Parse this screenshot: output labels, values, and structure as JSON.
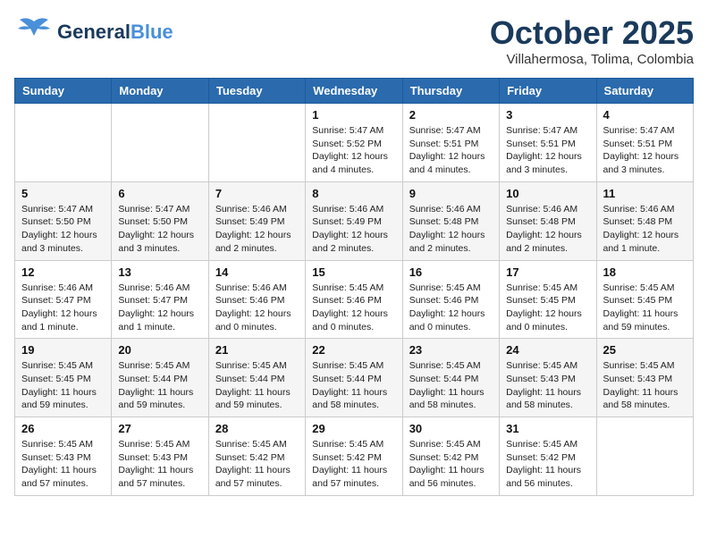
{
  "header": {
    "logo_general": "General",
    "logo_blue": "Blue",
    "month": "October 2025",
    "location": "Villahermosa, Tolima, Colombia"
  },
  "weekdays": [
    "Sunday",
    "Monday",
    "Tuesday",
    "Wednesday",
    "Thursday",
    "Friday",
    "Saturday"
  ],
  "weeks": [
    [
      {
        "day": "",
        "info": ""
      },
      {
        "day": "",
        "info": ""
      },
      {
        "day": "",
        "info": ""
      },
      {
        "day": "1",
        "info": "Sunrise: 5:47 AM\nSunset: 5:52 PM\nDaylight: 12 hours and 4 minutes."
      },
      {
        "day": "2",
        "info": "Sunrise: 5:47 AM\nSunset: 5:51 PM\nDaylight: 12 hours and 4 minutes."
      },
      {
        "day": "3",
        "info": "Sunrise: 5:47 AM\nSunset: 5:51 PM\nDaylight: 12 hours and 3 minutes."
      },
      {
        "day": "4",
        "info": "Sunrise: 5:47 AM\nSunset: 5:51 PM\nDaylight: 12 hours and 3 minutes."
      }
    ],
    [
      {
        "day": "5",
        "info": "Sunrise: 5:47 AM\nSunset: 5:50 PM\nDaylight: 12 hours and 3 minutes."
      },
      {
        "day": "6",
        "info": "Sunrise: 5:47 AM\nSunset: 5:50 PM\nDaylight: 12 hours and 3 minutes."
      },
      {
        "day": "7",
        "info": "Sunrise: 5:46 AM\nSunset: 5:49 PM\nDaylight: 12 hours and 2 minutes."
      },
      {
        "day": "8",
        "info": "Sunrise: 5:46 AM\nSunset: 5:49 PM\nDaylight: 12 hours and 2 minutes."
      },
      {
        "day": "9",
        "info": "Sunrise: 5:46 AM\nSunset: 5:48 PM\nDaylight: 12 hours and 2 minutes."
      },
      {
        "day": "10",
        "info": "Sunrise: 5:46 AM\nSunset: 5:48 PM\nDaylight: 12 hours and 2 minutes."
      },
      {
        "day": "11",
        "info": "Sunrise: 5:46 AM\nSunset: 5:48 PM\nDaylight: 12 hours and 1 minute."
      }
    ],
    [
      {
        "day": "12",
        "info": "Sunrise: 5:46 AM\nSunset: 5:47 PM\nDaylight: 12 hours and 1 minute."
      },
      {
        "day": "13",
        "info": "Sunrise: 5:46 AM\nSunset: 5:47 PM\nDaylight: 12 hours and 1 minute."
      },
      {
        "day": "14",
        "info": "Sunrise: 5:46 AM\nSunset: 5:46 PM\nDaylight: 12 hours and 0 minutes."
      },
      {
        "day": "15",
        "info": "Sunrise: 5:45 AM\nSunset: 5:46 PM\nDaylight: 12 hours and 0 minutes."
      },
      {
        "day": "16",
        "info": "Sunrise: 5:45 AM\nSunset: 5:46 PM\nDaylight: 12 hours and 0 minutes."
      },
      {
        "day": "17",
        "info": "Sunrise: 5:45 AM\nSunset: 5:45 PM\nDaylight: 12 hours and 0 minutes."
      },
      {
        "day": "18",
        "info": "Sunrise: 5:45 AM\nSunset: 5:45 PM\nDaylight: 11 hours and 59 minutes."
      }
    ],
    [
      {
        "day": "19",
        "info": "Sunrise: 5:45 AM\nSunset: 5:45 PM\nDaylight: 11 hours and 59 minutes."
      },
      {
        "day": "20",
        "info": "Sunrise: 5:45 AM\nSunset: 5:44 PM\nDaylight: 11 hours and 59 minutes."
      },
      {
        "day": "21",
        "info": "Sunrise: 5:45 AM\nSunset: 5:44 PM\nDaylight: 11 hours and 59 minutes."
      },
      {
        "day": "22",
        "info": "Sunrise: 5:45 AM\nSunset: 5:44 PM\nDaylight: 11 hours and 58 minutes."
      },
      {
        "day": "23",
        "info": "Sunrise: 5:45 AM\nSunset: 5:44 PM\nDaylight: 11 hours and 58 minutes."
      },
      {
        "day": "24",
        "info": "Sunrise: 5:45 AM\nSunset: 5:43 PM\nDaylight: 11 hours and 58 minutes."
      },
      {
        "day": "25",
        "info": "Sunrise: 5:45 AM\nSunset: 5:43 PM\nDaylight: 11 hours and 58 minutes."
      }
    ],
    [
      {
        "day": "26",
        "info": "Sunrise: 5:45 AM\nSunset: 5:43 PM\nDaylight: 11 hours and 57 minutes."
      },
      {
        "day": "27",
        "info": "Sunrise: 5:45 AM\nSunset: 5:43 PM\nDaylight: 11 hours and 57 minutes."
      },
      {
        "day": "28",
        "info": "Sunrise: 5:45 AM\nSunset: 5:42 PM\nDaylight: 11 hours and 57 minutes."
      },
      {
        "day": "29",
        "info": "Sunrise: 5:45 AM\nSunset: 5:42 PM\nDaylight: 11 hours and 57 minutes."
      },
      {
        "day": "30",
        "info": "Sunrise: 5:45 AM\nSunset: 5:42 PM\nDaylight: 11 hours and 56 minutes."
      },
      {
        "day": "31",
        "info": "Sunrise: 5:45 AM\nSunset: 5:42 PM\nDaylight: 11 hours and 56 minutes."
      },
      {
        "day": "",
        "info": ""
      }
    ]
  ]
}
